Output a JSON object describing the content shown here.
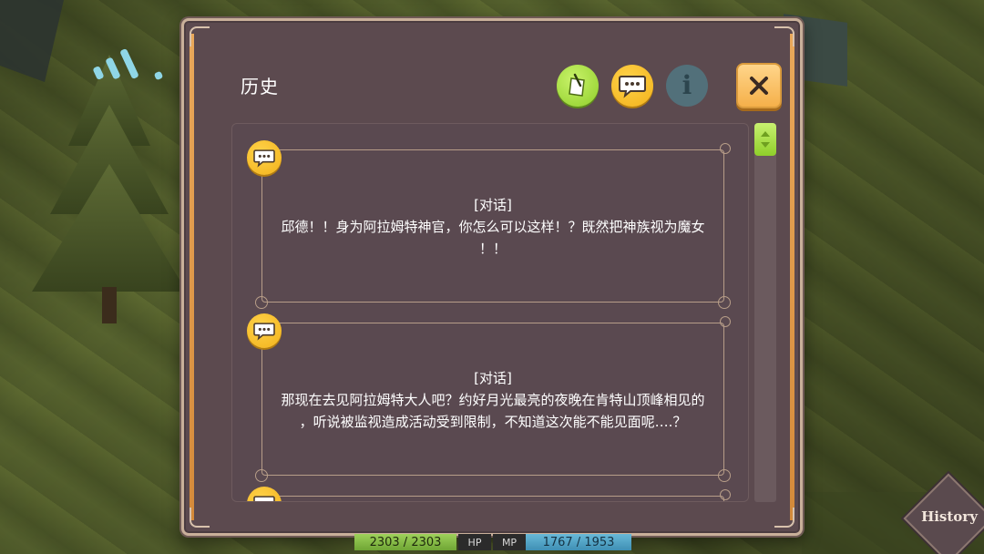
{
  "panel": {
    "title": "历史"
  },
  "toolbar": {
    "log_icon": "log-note-icon",
    "dialog_icon": "speech-bubble-icon",
    "info_icon": "info-icon",
    "info_glyph": "i",
    "close_icon": "close-icon"
  },
  "entries": [
    {
      "icon": "speech-bubble-icon",
      "tag": "[对话]",
      "lines": [
        "邱德！！身为阿拉姆特神官，你怎么可以这样！？既然把神族视为魔女",
        "！！"
      ]
    },
    {
      "icon": "speech-bubble-icon",
      "tag": "[对话]",
      "lines": [
        "那现在去见阿拉姆特大人吧？约好月光最亮的夜晚在肯特山顶峰相见的",
        "，听说被监视造成活动受到限制，不知道这次能不能见面呢….？"
      ]
    }
  ],
  "hud": {
    "hp_value": "2303 / 2303",
    "hp_label": "HP",
    "mp_label": "MP",
    "mp_value": "1767 / 1953"
  },
  "history_button": {
    "label": "History"
  },
  "colors": {
    "panel": "#5c4a4f",
    "accent_orange": "#f5b04a",
    "accent_green": "#8fcf2a",
    "accent_yellow": "#f2b21a"
  }
}
